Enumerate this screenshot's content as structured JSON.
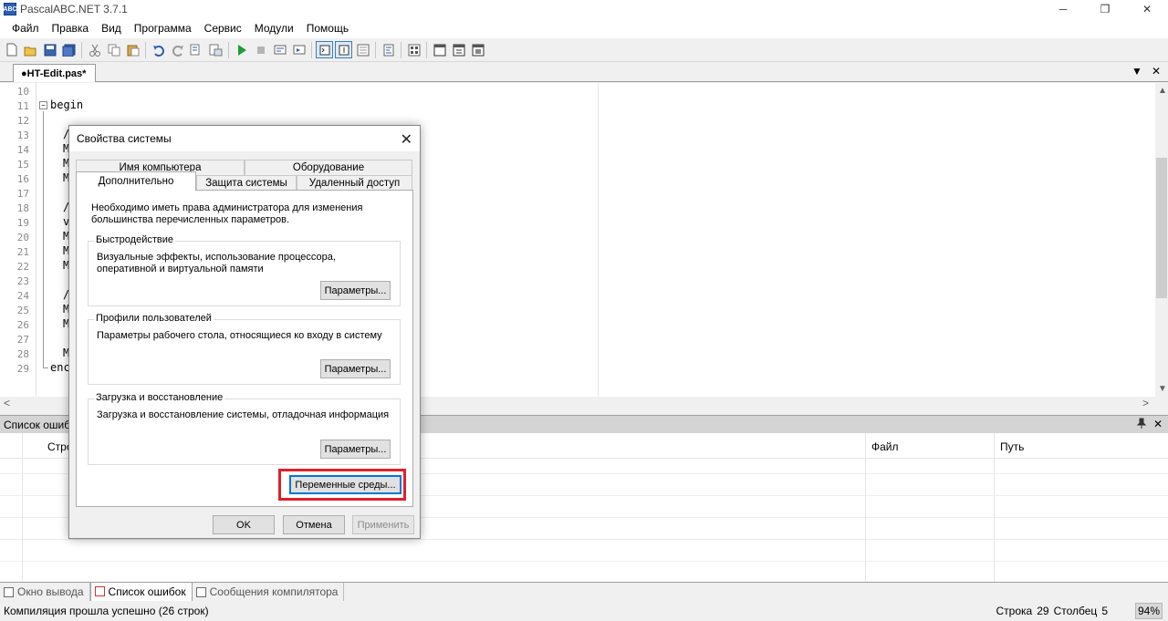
{
  "window": {
    "title": "PascalABC.NET 3.7.1",
    "icon_text": "ABC",
    "minimize": "─",
    "restore": "❐",
    "close": "✕"
  },
  "menu": [
    "Файл",
    "Правка",
    "Вид",
    "Программа",
    "Сервис",
    "Модули",
    "Помощь"
  ],
  "toolbar_icons": [
    "new-icon",
    "open-icon",
    "save-icon",
    "save-all-icon",
    "cut-icon",
    "copy-icon",
    "paste-icon",
    "undo-icon",
    "redo-icon",
    "find-icon",
    "replace-icon",
    "run-icon",
    "stop-icon",
    "step-icon",
    "step-into-icon",
    "console-icon",
    "output-icon",
    "watch-icon",
    "format-icon",
    "debug-icon",
    "form-icon",
    "compile-icon",
    "build-icon"
  ],
  "editor": {
    "tab_label": "●HT-Edit.pas*",
    "tab_menu": "▼",
    "tab_close": "✕",
    "fold_sign": "−",
    "line_numbers": [
      "10",
      "11",
      "12",
      "13",
      "14",
      "15",
      "16",
      "17",
      "18",
      "19",
      "20",
      "21",
      "22",
      "23",
      "24",
      "25",
      "26",
      "27",
      "28",
      "29"
    ],
    "code_begin": "begin",
    "code_end_fragment": "enc",
    "code_fragments": [
      {
        "line": "13",
        "text": "/"
      },
      {
        "line": "14",
        "text": "M"
      },
      {
        "line": "15",
        "text": "M"
      },
      {
        "line": "16",
        "text": "M"
      },
      {
        "line": "18",
        "text": "/"
      },
      {
        "line": "19",
        "text": "v"
      },
      {
        "line": "20",
        "text": "M"
      },
      {
        "line": "21",
        "text": "M"
      },
      {
        "line": "22",
        "text": "M"
      },
      {
        "line": "24",
        "text": "/"
      },
      {
        "line": "25",
        "text": "M"
      },
      {
        "line": "26",
        "text": "M"
      },
      {
        "line": "28",
        "text": "M"
      }
    ],
    "scroll_up": "▲",
    "scroll_down": "▼",
    "scroll_left": "<",
    "scroll_right": ">"
  },
  "error_panel": {
    "title": "Список ошибок",
    "pin": "📌",
    "close": "✕",
    "columns": {
      "line": "Строка",
      "file": "Файл",
      "path": "Путь"
    }
  },
  "bottom_tabs": [
    "Окно вывода",
    "Список ошибок",
    "Сообщения компилятора"
  ],
  "status": {
    "message": "Компиляция прошла успешно (26 строк)",
    "line_label": "Строка",
    "line_value": "29",
    "col_label": "Столбец",
    "col_value": "5",
    "zoom": "94%"
  },
  "dialog": {
    "title": "Свойства системы",
    "close": "✕",
    "tabs_row1": [
      "Имя компьютера",
      "Оборудование"
    ],
    "tabs_row2": [
      "Дополнительно",
      "Защита системы",
      "Удаленный доступ"
    ],
    "intro": "Необходимо иметь права администратора для изменения большинства перечисленных параметров.",
    "groups": [
      {
        "legend": "Быстродействие",
        "desc": "Визуальные эффекты, использование процессора, оперативной и виртуальной памяти",
        "button": "Параметры..."
      },
      {
        "legend": "Профили пользователей",
        "desc": "Параметры рабочего стола, относящиеся ко входу в систему",
        "button": "Параметры..."
      },
      {
        "legend": "Загрузка и восстановление",
        "desc": "Загрузка и восстановление системы, отладочная информация",
        "button": "Параметры..."
      }
    ],
    "env_button": "Переменные среды...",
    "ok": "OK",
    "cancel": "Отмена",
    "apply": "Применить",
    "highlight_color": "#e0202a"
  }
}
